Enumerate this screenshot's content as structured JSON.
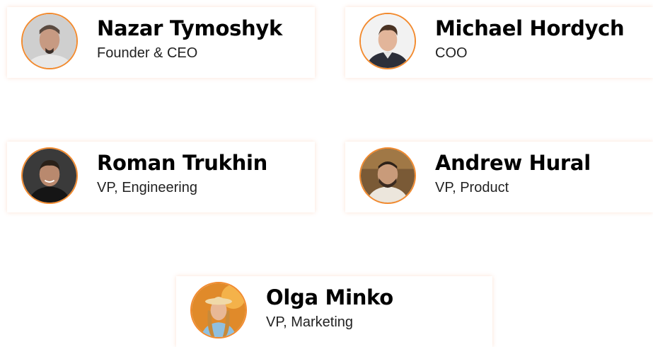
{
  "accent_color": "#f28a2e",
  "team": [
    {
      "name": "Nazar Tymoshyk",
      "role": "Founder & CEO",
      "photo": "portrait-photo"
    },
    {
      "name": "Michael Hordych",
      "role": "COO",
      "photo": "portrait-photo"
    },
    {
      "name": "Roman Trukhin",
      "role": "VP, Engineering",
      "photo": "portrait-photo"
    },
    {
      "name": "Andrew Hural",
      "role": "VP, Product",
      "photo": "portrait-photo"
    },
    {
      "name": "Olga Minko",
      "role": "VP, Marketing",
      "photo": "portrait-photo"
    }
  ]
}
